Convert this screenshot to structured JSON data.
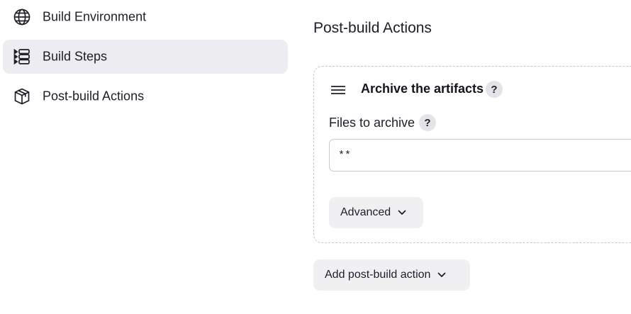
{
  "sidebar": {
    "items": [
      {
        "label": "Build Environment",
        "icon": "globe-icon",
        "active": false
      },
      {
        "label": "Build Steps",
        "icon": "list-steps-icon",
        "active": true
      },
      {
        "label": "Post-build Actions",
        "icon": "package-icon",
        "active": false
      }
    ]
  },
  "main": {
    "section_title": "Post-build Actions",
    "card": {
      "title": "Archive the artifacts",
      "help_glyph": "?",
      "field_label": "Files to archive",
      "field_value": "**",
      "advanced_label": "Advanced"
    },
    "add_action_label": "Add post-build action"
  },
  "colors": {
    "active_bg": "#ececf1",
    "button_bg": "#f0f0f3",
    "help_bg": "#e4e4e8",
    "border": "#c6c6cc"
  }
}
